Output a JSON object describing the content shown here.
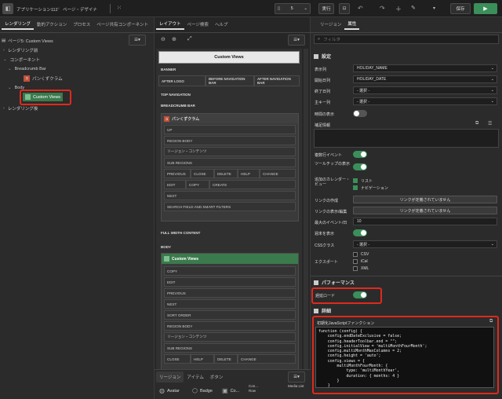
{
  "topbar": {
    "app_name": "アプリケーション112",
    "page_name": "ページ・デザイナ",
    "page_number": "5",
    "run_label": "実行",
    "save_label": "保存"
  },
  "left": {
    "tabs": [
      "レンダリング",
      "動的アクション",
      "プロセス",
      "ページ共有コンポーネント"
    ],
    "tree": {
      "page": "ページ5: Custom Views",
      "rendering_pre": "レンダリング前",
      "components": "コンポーネント",
      "breadcrumb_bar": "Breadcrumb Bar",
      "breadcrumb": "パンくずクラム",
      "body": "Body",
      "custom_views": "Custom Views",
      "rendering_post": "レンダリング後"
    }
  },
  "mid": {
    "tabs": [
      "レイアウト",
      "ページ検索",
      "ヘルプ"
    ],
    "page_title": "Custom Views",
    "banner": "BANNER",
    "after_logo": "AFTER LOGO",
    "before_nav": "BEFORE NAVIGATION BAR",
    "after_nav": "AFTER NAVIGATION BAR",
    "top_nav": "TOP NAVIGATION",
    "breadcrumb_bar": "BREADCRUMB BAR",
    "bc_region": "パンくずクラム",
    "bc_slots": [
      "UP",
      "REGION BODY",
      "リージョン・コンテンツ",
      "SUB REGIONS"
    ],
    "bc_buttons1": [
      "PREVIOUS",
      "CLOSE",
      "DELETE",
      "HELP",
      "CHANGE"
    ],
    "bc_buttons2": [
      "EDIT",
      "COPY",
      "CREATE"
    ],
    "bc_next": "NEXT",
    "bc_search": "SEARCH FIELD AND SMART FILTERS",
    "full_width": "FULL WIDTH CONTENT",
    "body": "BODY",
    "cv_region": "Custom Views",
    "cv_slots": [
      "COPY",
      "EDIT",
      "PREVIOUS",
      "NEXT",
      "SORT ORDER",
      "REGION BODY",
      "リージョン・コンテンツ",
      "SUB REGIONS"
    ],
    "cv_bottom": [
      "CLOSE",
      "HELP",
      "DELETE",
      "CHANGE"
    ],
    "bottom_tabs": [
      "リージョン",
      "アイテム",
      "ボタン"
    ],
    "gallery": [
      "Avatar",
      "Badge",
      "Co...",
      "Con...",
      "Row",
      "Media List"
    ]
  },
  "right": {
    "tabs": [
      "リージョン",
      "属性"
    ],
    "filter_placeholder": "フィルタ",
    "settings_title": "設定",
    "display_column_label": "表示列",
    "display_column_value": "HOLIDAY_NAME",
    "start_column_label": "開始日列",
    "start_column_value": "HOLIDAY_DATE",
    "end_column_label": "終了日列",
    "end_column_value": "- 選択 -",
    "primary_key_label": "主キー列",
    "primary_key_value": "- 選択 -",
    "show_time_label": "時間の表示",
    "extra_info_label": "補足情報",
    "drag_drop_label": "複数行イベント",
    "tooltip_label": "ツールチップの表示",
    "additional_views_label": "追加のカレンダー・ビュー",
    "list_label": "リスト",
    "navigation_label": "ナビゲーション",
    "create_link_label": "リンクの作成",
    "create_link_btn": "リンクが定義されていません",
    "view_edit_link_label": "リンクの表示/編集",
    "view_edit_link_btn": "リンクが定義されていません",
    "max_events_label": "最大のイベント/日",
    "max_events_value": "10",
    "show_weekend_label": "週末を表示",
    "css_class_label": "CSSクラス",
    "css_class_value": "- 選択 -",
    "export_label": "エクスポート",
    "export_options": [
      "CSV",
      "iCal",
      "XML"
    ],
    "performance_title": "パフォーマンス",
    "lazy_load_label": "遅延ロード",
    "advanced_title": "詳細",
    "init_js_label": "初期化JavaScriptファンクション",
    "code": "function (config) {\n    config.endDateExclusive = false;\n    config.headerToolbar.end = \"\";\n    config.initialView = 'multiMonthFourMonth';\n    config.multiMonthMaxColumns = 2;\n    config.height = 'auto';\n    config.views = {\n        multiMonthFourMonth: {\n            type: 'multiMonthYear',\n            duration: { months: 4 }\n        }\n    }\n}"
  },
  "colors": {
    "accent_green": "#3b8f5a",
    "highlight_red": "#e0291c"
  }
}
